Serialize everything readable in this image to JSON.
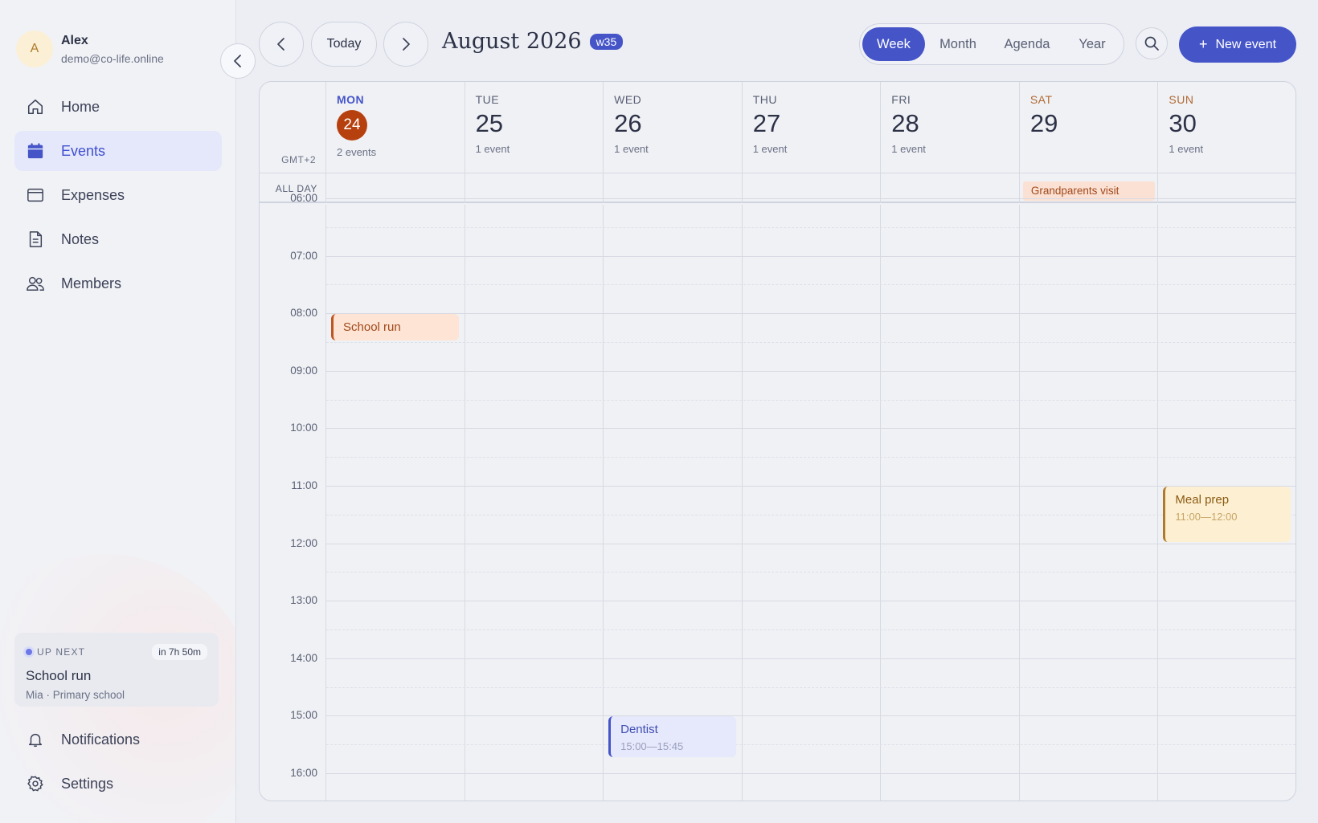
{
  "user": {
    "initial": "A",
    "name": "Alex",
    "email": "demo@co-life.online"
  },
  "sidebar": {
    "items": [
      {
        "label": "Home",
        "icon": "home-icon",
        "active": false
      },
      {
        "label": "Events",
        "icon": "calendar-icon",
        "active": true
      },
      {
        "label": "Expenses",
        "icon": "wallet-icon",
        "active": false
      },
      {
        "label": "Notes",
        "icon": "note-icon",
        "active": false
      },
      {
        "label": "Members",
        "icon": "members-icon",
        "active": false
      }
    ],
    "bottom_items": [
      {
        "label": "Notifications",
        "icon": "bell-icon"
      },
      {
        "label": "Settings",
        "icon": "gear-icon"
      }
    ]
  },
  "up_next": {
    "label": "UP NEXT",
    "countdown": "in 7h 50m",
    "title": "School run",
    "subtitle": "Mia · Primary school"
  },
  "toolbar": {
    "today_label": "Today",
    "month_title": "August 2026",
    "week_badge": "w35",
    "views": [
      "Week",
      "Month",
      "Agenda",
      "Year"
    ],
    "active_view": "Week",
    "new_event_label": "New event"
  },
  "calendar": {
    "timezone": "GMT+2",
    "allday_label": "ALL DAY",
    "days": [
      {
        "name": "MON",
        "num": "24",
        "count": "2 events",
        "today": true,
        "weekend": false
      },
      {
        "name": "TUE",
        "num": "25",
        "count": "1 event",
        "today": false,
        "weekend": false
      },
      {
        "name": "WED",
        "num": "26",
        "count": "1 event",
        "today": false,
        "weekend": false
      },
      {
        "name": "THU",
        "num": "27",
        "count": "1 event",
        "today": false,
        "weekend": false
      },
      {
        "name": "FRI",
        "num": "28",
        "count": "1 event",
        "today": false,
        "weekend": false
      },
      {
        "name": "SAT",
        "num": "29",
        "count": "",
        "today": false,
        "weekend": true
      },
      {
        "name": "SUN",
        "num": "30",
        "count": "1 event",
        "today": false,
        "weekend": true
      }
    ],
    "hours": [
      "06:00",
      "07:00",
      "08:00",
      "09:00",
      "10:00",
      "11:00",
      "12:00",
      "13:00",
      "14:00",
      "15:00",
      "16:00"
    ],
    "allday_events": [
      {
        "day": 5,
        "title": "Grandparents visit"
      }
    ],
    "events": [
      {
        "day": 0,
        "title": "School run",
        "time": "",
        "start": 8.0,
        "end": 8.5,
        "color": "orange"
      },
      {
        "day": 2,
        "title": "Dentist",
        "time": "15:00—15:45",
        "start": 15.0,
        "end": 15.75,
        "color": "blue"
      },
      {
        "day": 6,
        "title": "Meal prep",
        "time": "11:00—12:00",
        "start": 11.0,
        "end": 12.0,
        "color": "yellow"
      }
    ]
  }
}
